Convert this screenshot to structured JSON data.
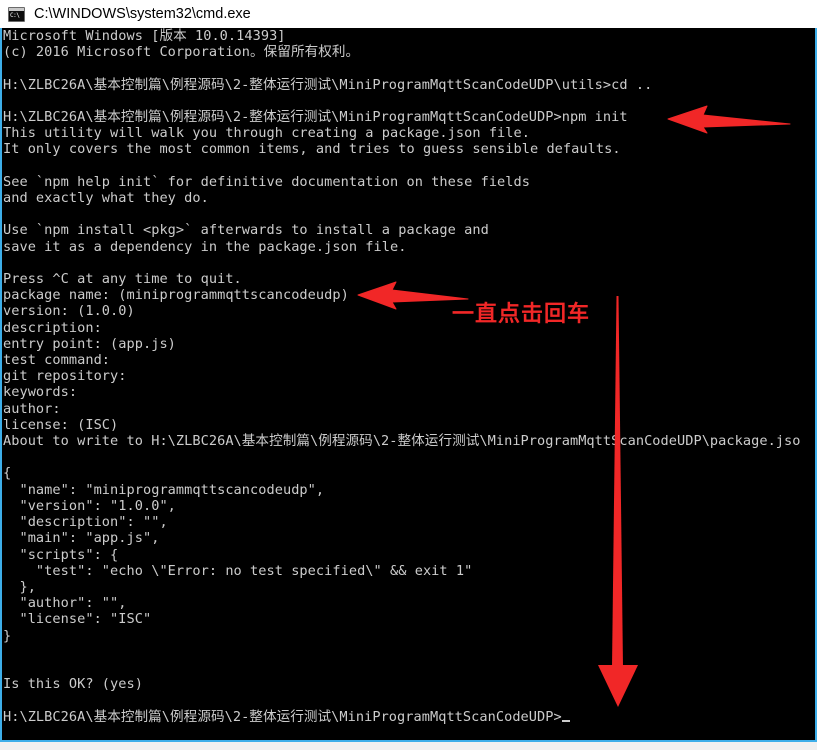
{
  "window": {
    "title": "C:\\WINDOWS\\system32\\cmd.exe",
    "icon": "cmd-console-icon",
    "icon_glyph": "C:\\",
    "border_color": "#3daee9",
    "background_color": "#000000",
    "text_color": "#cccccc"
  },
  "console": {
    "lines": [
      "Microsoft Windows [版本 10.0.14393]",
      "(c) 2016 Microsoft Corporation。保留所有权利。",
      "",
      "H:\\ZLBC26A\\基本控制篇\\例程源码\\2-整体运行测试\\MiniProgramMqttScanCodeUDP\\utils>cd ..",
      "",
      "H:\\ZLBC26A\\基本控制篇\\例程源码\\2-整体运行测试\\MiniProgramMqttScanCodeUDP>npm init",
      "This utility will walk you through creating a package.json file.",
      "It only covers the most common items, and tries to guess sensible defaults.",
      "",
      "See `npm help init` for definitive documentation on these fields",
      "and exactly what they do.",
      "",
      "Use `npm install <pkg>` afterwards to install a package and",
      "save it as a dependency in the package.json file.",
      "",
      "Press ^C at any time to quit.",
      "package name: (miniprogrammqttscancodeudp)",
      "version: (1.0.0)",
      "description:",
      "entry point: (app.js)",
      "test command:",
      "git repository:",
      "keywords:",
      "author:",
      "license: (ISC)",
      "About to write to H:\\ZLBC26A\\基本控制篇\\例程源码\\2-整体运行测试\\MiniProgramMqttScanCodeUDP\\package.jso",
      "",
      "{",
      "  \"name\": \"miniprogrammqttscancodeudp\",",
      "  \"version\": \"1.0.0\",",
      "  \"description\": \"\",",
      "  \"main\": \"app.js\",",
      "  \"scripts\": {",
      "    \"test\": \"echo \\\"Error: no test specified\\\" && exit 1\"",
      "  },",
      "  \"author\": \"\",",
      "  \"license\": \"ISC\"",
      "}",
      "",
      "",
      "Is this OK? (yes)",
      "",
      "H:\\ZLBC26A\\基本控制篇\\例程源码\\2-整体运行测试\\MiniProgramMqttScanCodeUDP>"
    ],
    "prompt_caret": "_"
  },
  "annotations": {
    "color": "#f12727",
    "note_text": "一直点击回车",
    "arrows": [
      {
        "name": "arrow-npm-init",
        "direction": "left",
        "target": "npm init command"
      },
      {
        "name": "arrow-package-name",
        "direction": "left",
        "target": "package name prompt"
      },
      {
        "name": "arrow-enter-sequence",
        "direction": "down",
        "target": "final prompt"
      }
    ]
  }
}
